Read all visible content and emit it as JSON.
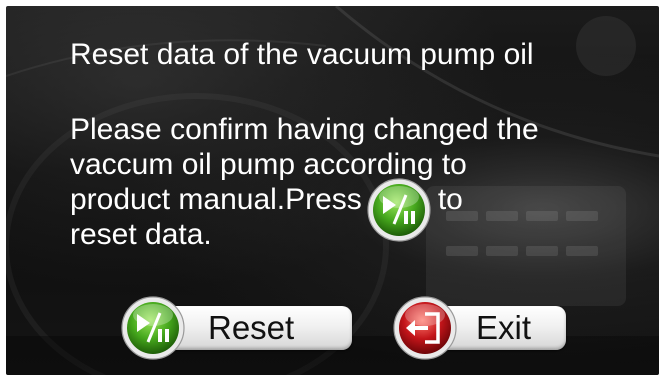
{
  "dialog": {
    "title": "Reset data of the vacuum pump oil",
    "message": {
      "line1": "Please confirm having changed the",
      "line2": "vaccum oil pump  according to",
      "line3_before": "product manual.Press",
      "line3_after": "to",
      "line4": "reset data."
    }
  },
  "buttons": {
    "reset_label": "Reset",
    "exit_label": "Exit"
  },
  "icons": {
    "play_pause": "play-pause-icon",
    "exit": "exit-door-icon"
  },
  "colors": {
    "background": "#111111",
    "text": "#ffffff",
    "play_green": "#46a81d",
    "exit_red": "#c3151a",
    "button_face": "#f1f1f1"
  }
}
